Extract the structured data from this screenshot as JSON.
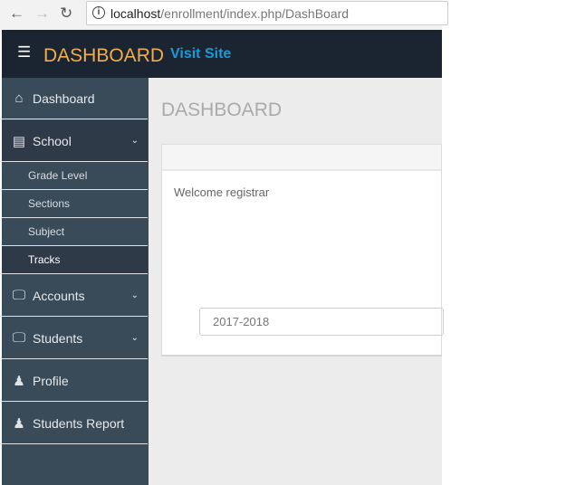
{
  "browser": {
    "url_host": "localhost",
    "url_path": "/enrollment/index.php/DashBoard"
  },
  "topbar": {
    "brand": "DASHBOARD",
    "visit_site": "Visit Site"
  },
  "sidebar": {
    "dashboard": "Dashboard",
    "school": "School",
    "school_sub": [
      "Grade Level",
      "Sections",
      "Subject",
      "Tracks"
    ],
    "accounts": "Accounts",
    "students": "Students",
    "profile": "Profile",
    "students_report": "Students Report"
  },
  "main": {
    "title": "DASHBOARD",
    "welcome": "Welcome registrar",
    "school_year": "2017-2018"
  }
}
